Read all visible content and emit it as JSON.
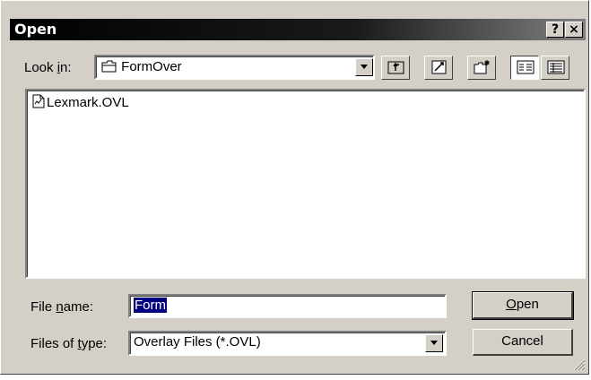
{
  "window": {
    "title": "Open",
    "help_button": "?",
    "close_button": "×"
  },
  "look_in": {
    "label_pre": "Look ",
    "label_accel": "i",
    "label_post": "n:",
    "value": "FormOver",
    "icon": "folder-icon"
  },
  "toolbar": {
    "buttons": [
      {
        "name": "up-one-level",
        "icon": "up-folder-icon"
      },
      {
        "name": "desktop",
        "icon": "desktop-icon"
      },
      {
        "name": "create-new-folder",
        "icon": "new-folder-icon"
      },
      {
        "name": "list-view",
        "icon": "list-view-icon"
      },
      {
        "name": "details-view",
        "icon": "details-view-icon"
      }
    ]
  },
  "files": [
    {
      "name": "Lexmark.OVL",
      "icon": "document-icon"
    }
  ],
  "file_name": {
    "label_pre": "File ",
    "label_accel": "n",
    "label_post": "ame:",
    "value": "Form"
  },
  "file_type": {
    "label_pre": "Files of ",
    "label_accel": "t",
    "label_post": "ype:",
    "value": "Overlay Files (*.OVL)"
  },
  "buttons": {
    "open_accel": "O",
    "open_rest": "pen",
    "cancel": "Cancel"
  },
  "colors": {
    "face": "#d4d0c8",
    "selection": "#000080",
    "title_bar": "#000000"
  }
}
